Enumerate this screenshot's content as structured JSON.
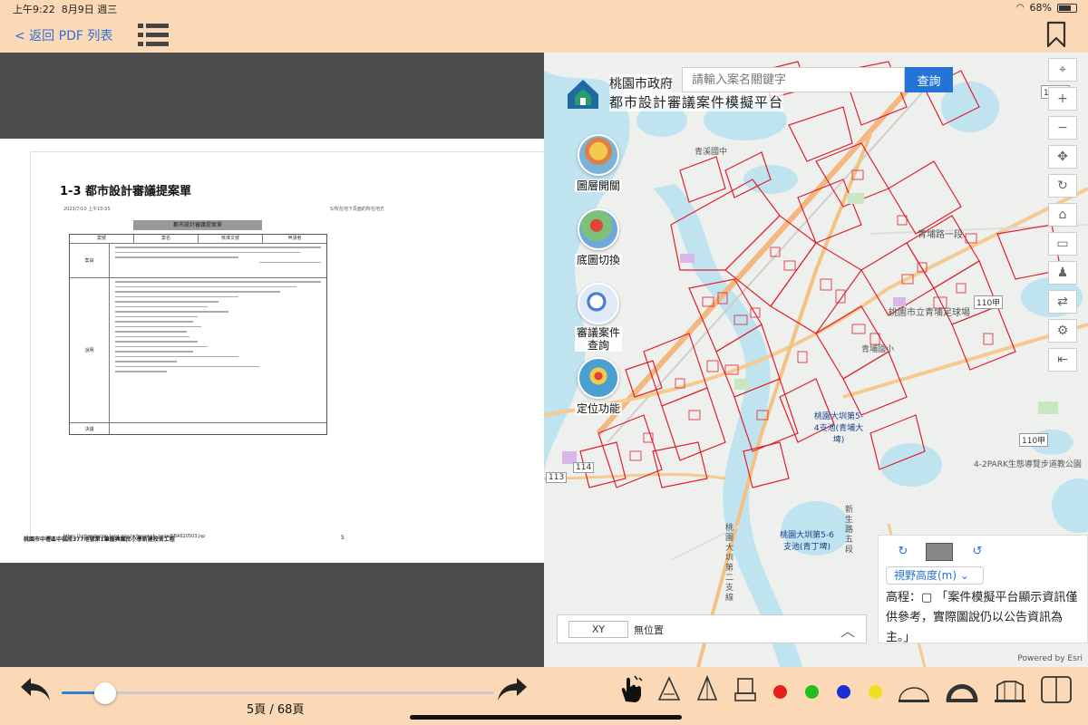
{
  "status": {
    "time": "上午9:22",
    "date": "8月9日 週三",
    "battery": "68%"
  },
  "topbar": {
    "back_label": "< 返回 PDF 列表"
  },
  "pdf": {
    "heading": "1-3 都市設計審議提案單",
    "date_line": "2023/7/10 上午10:35",
    "header_right": "5/所在地下頁面的所在地方",
    "form_title": "都市設計審議提案單",
    "col_headers": [
      "案號",
      "案名",
      "核准文號",
      "申請者"
    ],
    "row_labels": [
      "案由",
      "說明",
      "決議"
    ],
    "url": "https://urbandesign.tycg.gov.tw/tyssweb_page/SBA620503.jsp",
    "footer_title": "桃園市中壢區中福段377地號第1筆龍興國民小學新建校舍工程",
    "footer_page": "5"
  },
  "map": {
    "logo_line1": "桃園市政府",
    "logo_line2": "都市設計審議案件模擬平台",
    "search_placeholder": "請輸入案名關鍵字",
    "search_button": "查詢",
    "tools": [
      {
        "label": "圖層開關"
      },
      {
        "label": "底圖切換"
      },
      {
        "label": "審議案件查詢"
      },
      {
        "label": "定位功能"
      }
    ],
    "xy_field": "XY",
    "xy_status": "無位置",
    "view_height_label": "視野高度(m)",
    "elevation_text": "高程：▢ 「案件模擬平台顯示資訊僅供參考，實際圖說仍以公告資訊為主。」",
    "attribution": "Powered by Esri",
    "place_labels": [
      "青埔路一段",
      "桃園市立青埔足球場",
      "桃園大圳第5-4支池(青埔大埤)",
      "桃園大圳第5-6支池(青丁埤)",
      "4-2PARK生態導覽步道教公園",
      "青埔國小",
      "青溪國中",
      "新生路五段",
      "桃園大圳第二支線"
    ],
    "road_labels": [
      "110甲",
      "110甲",
      "110甲",
      "113",
      "114"
    ]
  },
  "bottom": {
    "page_indicator": "5頁 / 68頁",
    "current_page": 5,
    "total_pages": 68,
    "pen_colors": [
      "#e8201c",
      "#1fbf1f",
      "#1a2fd6",
      "#f0e020"
    ]
  }
}
